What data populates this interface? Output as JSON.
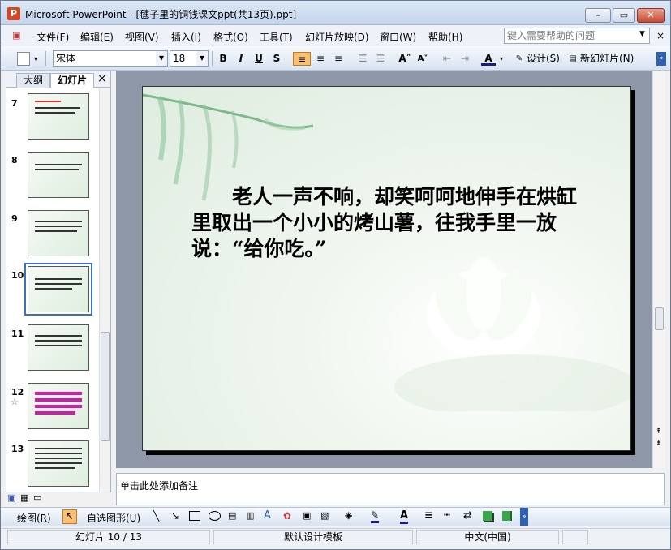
{
  "window": {
    "title": "Microsoft PowerPoint - [毽子里的铜钱课文ppt(共13页).ppt]"
  },
  "menu": {
    "items": [
      "文件(F)",
      "编辑(E)",
      "视图(V)",
      "插入(I)",
      "格式(O)",
      "工具(T)",
      "幻灯片放映(D)",
      "窗口(W)",
      "帮助(H)"
    ],
    "help_placeholder": "键入需要帮助的问题"
  },
  "toolbar": {
    "font": "宋体",
    "size": "18",
    "design_label": "设计(S)",
    "new_slide_label": "新幻灯片(N)"
  },
  "panel": {
    "tab_outline": "大纲",
    "tab_slides": "幻灯片",
    "close": "×",
    "slide_numbers": [
      "7",
      "8",
      "9",
      "10",
      "11",
      "12",
      "13"
    ]
  },
  "slide": {
    "text": "　　老人一声不响，却笑呵呵地伸手在烘缸里取出一个小小的烤山薯，往我手里一放说：“给你吃。”"
  },
  "notes": {
    "placeholder": "单击此处添加备注"
  },
  "drawing": {
    "draw_label": "绘图(R)",
    "autoshapes_label": "自选图形(U)"
  },
  "status": {
    "slide": "幻灯片 10 / 13",
    "template": "默认设计模板",
    "language": "中文(中国)"
  }
}
